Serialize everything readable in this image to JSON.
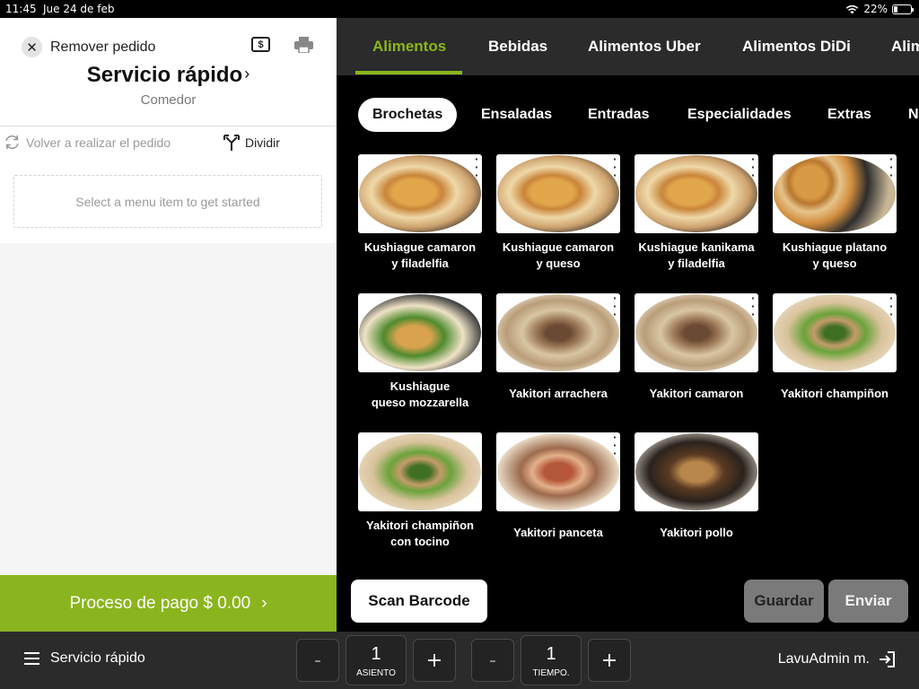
{
  "status_bar": {
    "time": "11:45",
    "date": "Jue 24 de feb",
    "battery": "22%"
  },
  "order": {
    "remove_label": "Remover pedido",
    "cash_icon_glyph": "$",
    "title": "Servicio rápido",
    "subtitle": "Comedor",
    "redo_label": "Volver a realizar el pedido",
    "split_label": "Dividir",
    "empty_hint": "Select a menu item to get started",
    "pay_label": "Proceso de pago $ 0.00"
  },
  "categories": [
    "Alimentos",
    "Bebidas",
    "Alimentos Uber",
    "Alimentos DiDi",
    "Alim"
  ],
  "subcategories": [
    "Brochetas",
    "Ensaladas",
    "Entradas",
    "Especialidades",
    "Extras",
    "N"
  ],
  "items": [
    {
      "name": "Kushiague camaron\ny filadelfia"
    },
    {
      "name": "Kushiague camaron\ny queso"
    },
    {
      "name": "Kushiague kanikama\ny filadelfia"
    },
    {
      "name": "Kushiague platano\ny queso"
    },
    {
      "name": "Kushiague\nqueso mozzarella"
    },
    {
      "name": "Yakitori arrachera"
    },
    {
      "name": "Yakitori camaron"
    },
    {
      "name": "Yakitori champiñon"
    },
    {
      "name": "Yakitori champiñon\ncon tocino"
    },
    {
      "name": "Yakitori panceta"
    },
    {
      "name": "Yakitori pollo"
    }
  ],
  "actions": {
    "scan_label": "Scan Barcode",
    "save_label": "Guardar",
    "send_label": "Enviar"
  },
  "bottom": {
    "menu_label": "Servicio rápido",
    "seat": {
      "minus": "-",
      "value": "1",
      "label": "ASIENTO",
      "plus": "+"
    },
    "course": {
      "minus": "-",
      "value": "1",
      "label": "TIEMPO.",
      "plus": "+"
    },
    "user_label": "LavuAdmin m."
  },
  "colors": {
    "accent": "#8bb51e",
    "dark_bar": "#2b2b2b",
    "disabled_button": "#7a7a7a"
  }
}
